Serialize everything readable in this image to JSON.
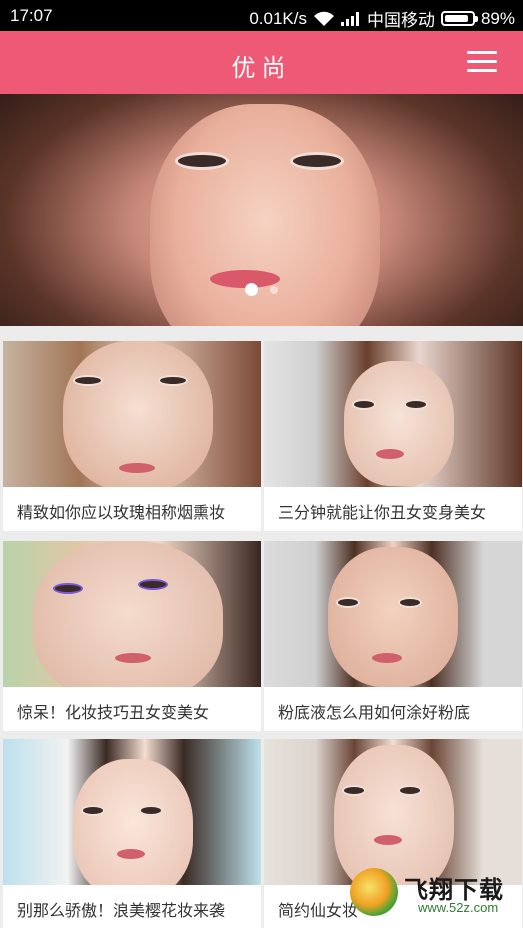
{
  "status_bar": {
    "time": "17:07",
    "net_speed": "0.01K/s",
    "carrier": "中国移动",
    "battery": "89%",
    "battery_level": 0.89
  },
  "app_bar": {
    "title": "优尚",
    "menu_icon": "hamburger-menu-icon"
  },
  "banner": {
    "slide_count": 2,
    "active_index": 0
  },
  "cards": [
    {
      "caption": "精致如你应以玫瑰相称烟熏妆"
    },
    {
      "caption": "三分钟就能让你丑女变身美女"
    },
    {
      "caption": "惊呆！化妆技巧丑女变美女"
    },
    {
      "caption": "粉底液怎么用如何涂好粉底"
    },
    {
      "caption": "别那么骄傲！浪美樱花妆来袭"
    },
    {
      "caption": "简约仙女妆"
    }
  ],
  "watermark": {
    "brand": "飞翔下载",
    "url": "www.52z.com"
  },
  "colors": {
    "accent": "#ee5a76",
    "background": "#ececec"
  }
}
